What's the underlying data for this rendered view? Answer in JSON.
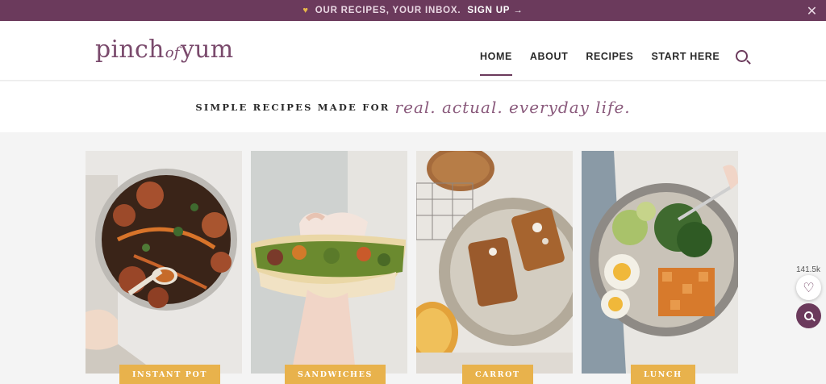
{
  "promo": {
    "message": "OUR RECIPES, YOUR INBOX.",
    "cta": "SIGN UP",
    "arrow": "→",
    "close": "✕",
    "heart": "♥"
  },
  "brand": {
    "part1": "pinch",
    "part2": "of",
    "part3": "yum"
  },
  "nav": {
    "items": [
      "HOME",
      "ABOUT",
      "RECIPES",
      "START HERE"
    ]
  },
  "tagline": {
    "plain": "SIMPLE RECIPES MADE FOR",
    "script": "real. actual. everyday life."
  },
  "categories": [
    {
      "label": "INSTANT POT",
      "image": "instant-pot-stew-bowl-photo"
    },
    {
      "label": "SANDWICHES",
      "image": "pita-sandwich-held-photo"
    },
    {
      "label": "CARROT",
      "image": "carrot-muffin-loaf-plate-photo"
    },
    {
      "label": "LUNCH",
      "image": "sweet-potato-egg-bowl-photo"
    }
  ],
  "social": {
    "count": "141.5k",
    "heart": "♡"
  },
  "colors": {
    "brand": "#6b3a5c",
    "accent": "#e8b24c"
  }
}
